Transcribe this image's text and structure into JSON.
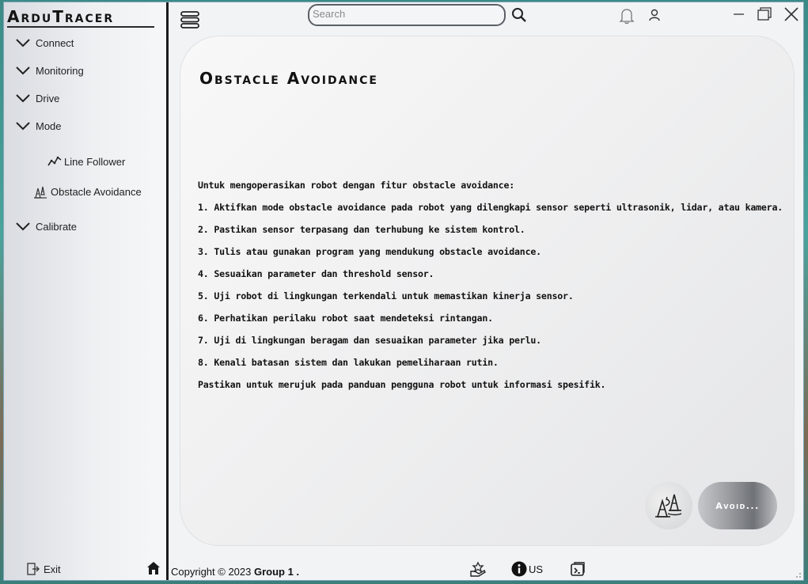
{
  "app": {
    "logo": "ArduTracer"
  },
  "sidebar": {
    "items": [
      {
        "label": "Connect"
      },
      {
        "label": "Monitoring"
      },
      {
        "label": "Drive"
      },
      {
        "label": "Mode"
      },
      {
        "label": "Calibrate"
      }
    ],
    "mode_subitems": [
      {
        "label": "Line Follower",
        "icon": "line-chart-icon"
      },
      {
        "label": "Obstacle Avoidance",
        "icon": "traffic-cones-icon"
      }
    ],
    "exit_label": "Exit"
  },
  "topbar": {
    "search_placeholder": "Search"
  },
  "main": {
    "title": "Obstacle Avoidance",
    "intro": "Untuk mengoperasikan robot dengan fitur obstacle avoidance:",
    "steps": [
      "1. Aktifkan mode obstacle avoidance pada robot yang dilengkapi sensor seperti ultrasonik, lidar, atau kamera.",
      "2. Pastikan sensor terpasang dan terhubung ke sistem kontrol.",
      "3. Tulis atau gunakan program yang mendukung obstacle avoidance.",
      "4. Sesuaikan parameter dan threshold sensor.",
      "5. Uji robot di lingkungan terkendali untuk memastikan kinerja sensor.",
      "6. Perhatikan perilaku robot saat mendeteksi rintangan.",
      "7. Uji di lingkungan beragam dan sesuaikan parameter jika perlu.",
      "8. Kenali batasan sistem dan lakukan pemeliharaan rutin."
    ],
    "closing": "Pastikan untuk merujuk pada panduan pengguna robot untuk informasi spesifik.",
    "avoid_button": "Avoid..."
  },
  "footer": {
    "copyright_prefix": "Copyright © 2023 ",
    "group": "Group 1 .",
    "info_label": "US"
  }
}
